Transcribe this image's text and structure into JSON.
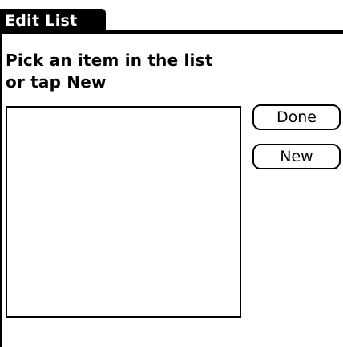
{
  "form": {
    "title": "Edit List",
    "prompt_line1": "Pick an item in the list",
    "prompt_line2": "or tap New"
  },
  "list": {
    "items": []
  },
  "buttons": {
    "done_label": "Done",
    "new_label": "New"
  }
}
